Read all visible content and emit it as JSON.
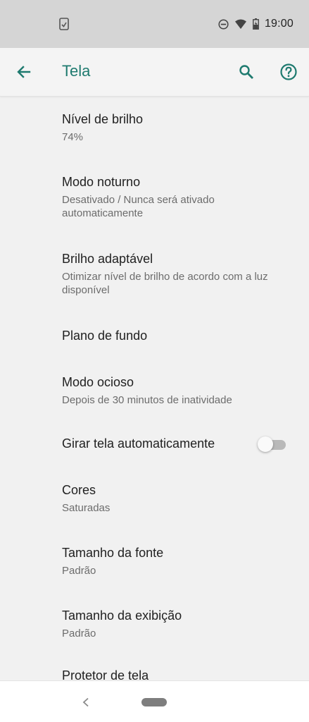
{
  "status_bar": {
    "time": "19:00",
    "icons": [
      "screenshot-icon",
      "do-not-disturb-icon",
      "wifi-icon",
      "battery-charging-icon"
    ]
  },
  "app_bar": {
    "title": "Tela",
    "back_icon": "arrow-back-icon",
    "search_icon": "search-icon",
    "help_icon": "help-icon"
  },
  "colors": {
    "accent": "#1e7a6f",
    "background": "#f1f1f1",
    "status_bar": "#d5d5d5",
    "title_text": "#212121",
    "summary_text": "#6c6c6c"
  },
  "settings": [
    {
      "title": "Nível de brilho",
      "summary": "74%"
    },
    {
      "title": "Modo noturno",
      "summary": "Desativado / Nunca será ativado automaticamente"
    },
    {
      "title": "Brilho adaptável",
      "summary": "Otimizar nível de brilho de acordo com a luz disponível"
    },
    {
      "title": "Plano de fundo",
      "summary": ""
    },
    {
      "title": "Modo ocioso",
      "summary": "Depois de 30 minutos de inatividade"
    },
    {
      "title": "Girar tela automaticamente",
      "summary": "",
      "toggle_on": false
    },
    {
      "title": "Cores",
      "summary": "Saturadas"
    },
    {
      "title": "Tamanho da fonte",
      "summary": "Padrão"
    },
    {
      "title": "Tamanho da exibição",
      "summary": "Padrão"
    },
    {
      "title": "Protetor de tela",
      "summary": ""
    }
  ],
  "nav_bar": {
    "back_icon": "nav-back-icon",
    "home_icon": "home-pill-icon"
  }
}
